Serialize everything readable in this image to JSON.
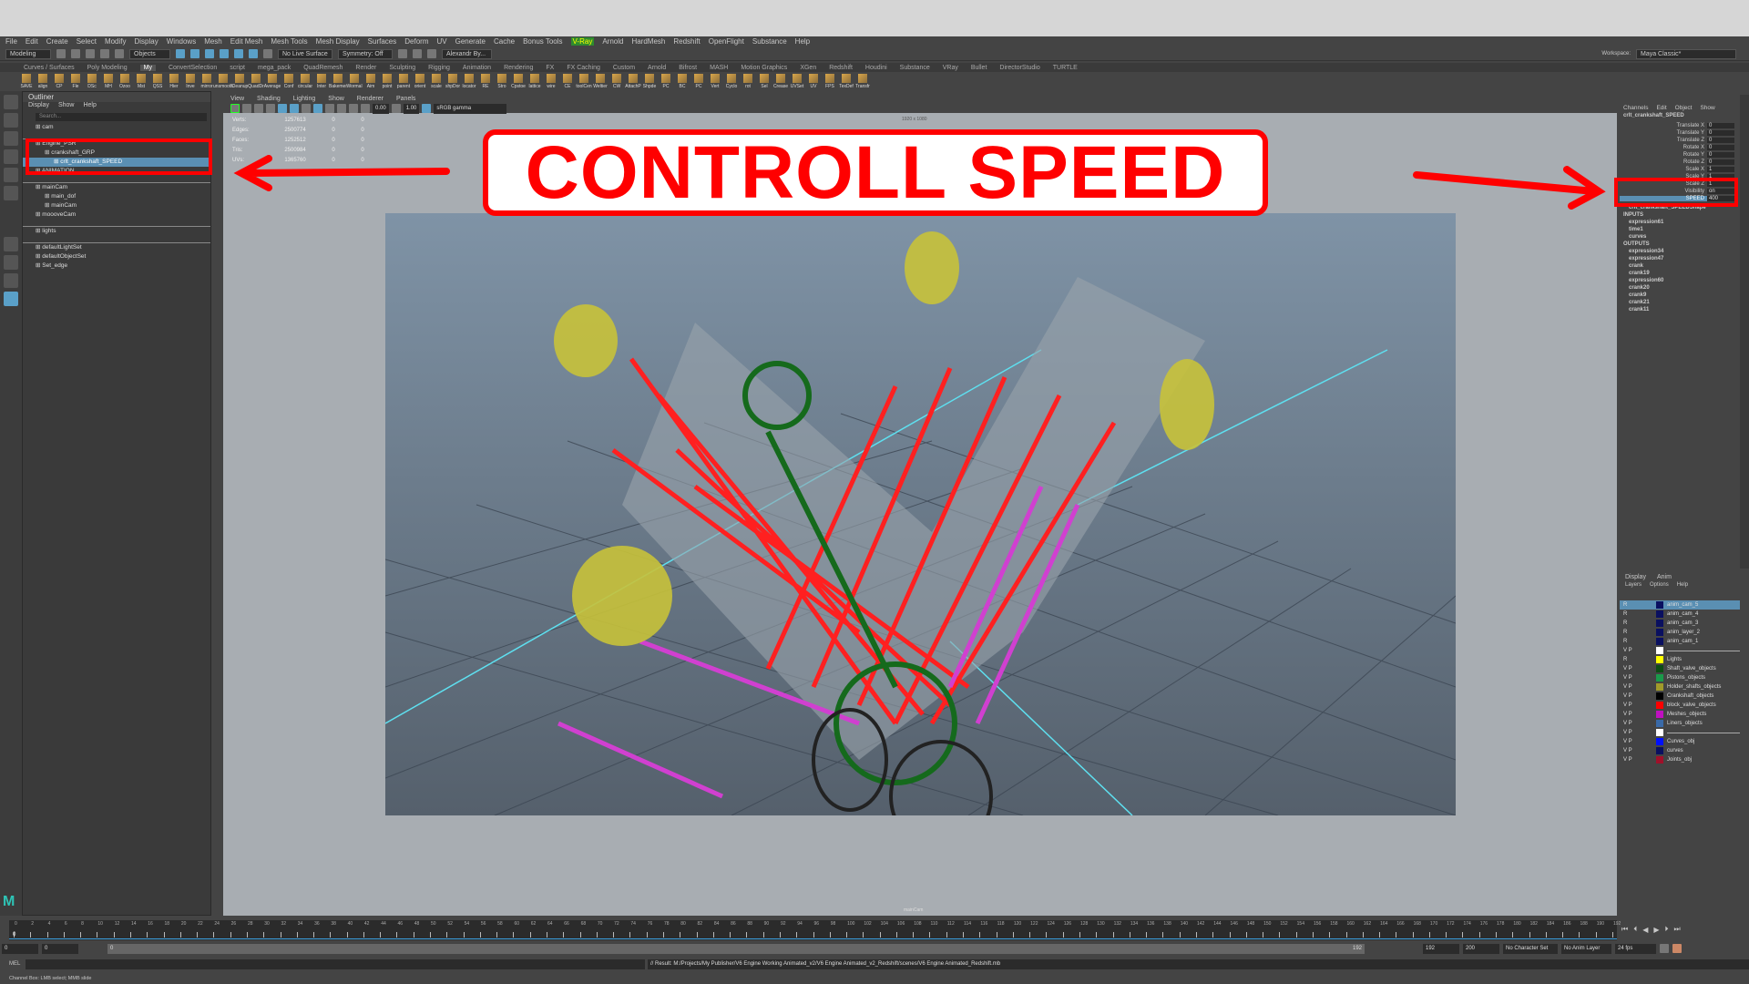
{
  "menubar": [
    "File",
    "Edit",
    "Create",
    "Select",
    "Modify",
    "Display",
    "Windows",
    "Mesh",
    "Edit Mesh",
    "Mesh Tools",
    "Mesh Display",
    "Surfaces",
    "Deform",
    "UV",
    "Generate",
    "Cache",
    "Bonus Tools",
    "V-Ray",
    "Arnold",
    "HardMesh",
    "Redshift",
    "OpenFlight",
    "Substance",
    "Help"
  ],
  "statusline": {
    "mode": "Modeling",
    "select_mode": "Objects",
    "live_surface": "No Live Surface",
    "symmetry": "Symmetry: Off",
    "user": "Alexandr By...",
    "workspace_label": "Workspace:",
    "workspace": "Maya Classic*"
  },
  "shelf_tabs": [
    "Curves / Surfaces",
    "Poly Modeling",
    "My",
    "ConvertSelection",
    "script",
    "mega_pack",
    "QuadRemesh",
    "Render",
    "Sculpting",
    "Rigging",
    "Animation",
    "Rendering",
    "FX",
    "FX Caching",
    "Custom",
    "Arnold",
    "Bifrost",
    "MASH",
    "Motion Graphics",
    "XGen",
    "Redshift",
    "Houdini",
    "Substance",
    "VRay",
    "Bullet",
    "DirectorStudio",
    "TURTLE"
  ],
  "shelf_active": "My",
  "shelf_buttons": [
    "SAVE",
    "align",
    "CP",
    "Fle",
    "DSc",
    "MH",
    "Ozoo",
    "Mst",
    "QSS",
    "Hier",
    "Inve",
    "mirror",
    "unsmooth",
    "Cleanup",
    "QuadDr",
    "Average",
    "Conf",
    "circular",
    "Inter",
    "Bakemer",
    "Wormal",
    "Aim",
    "point",
    "parent",
    "orient",
    "scale",
    "shpDor",
    "locator",
    "RE",
    "Stro",
    "Cpstoe",
    "lattice",
    "wire",
    "CE",
    "toolCen",
    "Weltier",
    "CW",
    "AttachP",
    "Shpde",
    "PC",
    "BC",
    "PC",
    "Vert",
    "Cyclo",
    "rot",
    "Sel",
    "Crease",
    "UVSet",
    "UV",
    "FPS",
    "TexDef",
    "Transfr"
  ],
  "outliner": {
    "title": "Outliner",
    "menus": [
      "Display",
      "Show",
      "Help"
    ],
    "search_placeholder": "Search...",
    "items": [
      {
        "label": "cam",
        "indent": 0,
        "sel": false
      },
      {
        "label": "",
        "indent": 0,
        "sep": true
      },
      {
        "label": "Engine_PSR",
        "indent": 0
      },
      {
        "label": "crankshaft_GRP",
        "indent": 1
      },
      {
        "label": "crlt_crankshaft_SPEED",
        "indent": 2,
        "sel": true
      },
      {
        "label": "ANIMATION",
        "indent": 0
      },
      {
        "label": "",
        "indent": 0,
        "sep": true
      },
      {
        "label": "mainCam",
        "indent": 0
      },
      {
        "label": "main_dof",
        "indent": 1
      },
      {
        "label": "mainCam",
        "indent": 1
      },
      {
        "label": "moooveCam",
        "indent": 0
      },
      {
        "label": "",
        "indent": 0,
        "sep": true
      },
      {
        "label": "lights",
        "indent": 0
      },
      {
        "label": "",
        "indent": 0,
        "sep": true
      },
      {
        "label": "defaultLightSet",
        "indent": 0
      },
      {
        "label": "defaultObjectSet",
        "indent": 0
      },
      {
        "label": "Set_edge",
        "indent": 0
      }
    ]
  },
  "viewport": {
    "menus": [
      "View",
      "Shading",
      "Lighting",
      "Show",
      "Renderer",
      "Panels"
    ],
    "exposure": "0.00",
    "gamma": "1.00",
    "color_space": "sRGB gamma",
    "resolution": "1920 x 1080",
    "camera": "mainCam",
    "hud": [
      [
        "Verts:",
        "1257613",
        "0",
        "0"
      ],
      [
        "Edges:",
        "2500774",
        "0",
        "0"
      ],
      [
        "Faces:",
        "1252512",
        "0",
        "0"
      ],
      [
        "Tris:",
        "2500984",
        "0",
        "0"
      ],
      [
        "UVs:",
        "1365760",
        "0",
        "0"
      ]
    ],
    "banner": "CONTROLL SPEED"
  },
  "channel_box": {
    "menus": [
      "Channels",
      "Edit",
      "Object",
      "Show"
    ],
    "node": "crlt_crankshaft_SPEED",
    "attrs": [
      [
        "Translate X",
        "0"
      ],
      [
        "Translate Y",
        "0"
      ],
      [
        "Translate Z",
        "0"
      ],
      [
        "Rotate X",
        "0"
      ],
      [
        "Rotate Y",
        "0"
      ],
      [
        "Rotate Z",
        "0"
      ],
      [
        "Scale X",
        "1"
      ],
      [
        "Scale Y",
        "1"
      ],
      [
        "Scale Z",
        "1"
      ],
      [
        "Visibility",
        "on"
      ],
      [
        "SPEED",
        "400"
      ]
    ],
    "shape": "crlt_crankshaft_SPEEDShape",
    "inputs_label": "INPUTS",
    "inputs": [
      "expression61",
      "time1",
      "curves"
    ],
    "outputs_label": "OUTPUTS",
    "outputs": [
      "expression34",
      "expression47",
      "crank",
      "crank19",
      "expression60",
      "crank20",
      "crank9",
      "crank21",
      "crank11"
    ]
  },
  "layers": {
    "tabs": [
      "Display",
      "Anim"
    ],
    "menus": [
      "Layers",
      "Options",
      "Help"
    ],
    "rows": [
      {
        "vp": "R",
        "name": "anim_cam_5",
        "color": "#0a1060",
        "sel": true
      },
      {
        "vp": "R",
        "name": "anim_cam_4",
        "color": "#0a1060"
      },
      {
        "vp": "R",
        "name": "anim_cam_3",
        "color": "#0a1060"
      },
      {
        "vp": "R",
        "name": "anim_layer_2",
        "color": "#0a1060"
      },
      {
        "vp": "R",
        "name": "anim_cam_1",
        "color": "#0a1060"
      },
      {
        "vp": "V P",
        "name": "",
        "color": "#ffffff",
        "sep": true
      },
      {
        "vp": "R",
        "name": "Lights",
        "color": "#ffff00"
      },
      {
        "vp": "V P",
        "name": "Shaft_valve_objects",
        "color": "#0d4d14"
      },
      {
        "vp": "V P",
        "name": "Pistons_objects",
        "color": "#1a9a4a"
      },
      {
        "vp": "V P",
        "name": "Holder_shafts_objects",
        "color": "#a09a2a"
      },
      {
        "vp": "V P",
        "name": "Crankshaft_objects",
        "color": "#000000"
      },
      {
        "vp": "V P",
        "name": "block_valve_objects",
        "color": "#ff0000"
      },
      {
        "vp": "V P",
        "name": "Meshes_objects",
        "color": "#c010c0"
      },
      {
        "vp": "V P",
        "name": "Liners_objects",
        "color": "#3a6aa8"
      },
      {
        "vp": "V P",
        "name": "",
        "color": "#ffffff",
        "sep": true
      },
      {
        "vp": "V P",
        "name": "Curves_obj",
        "color": "#0010ff"
      },
      {
        "vp": "V P",
        "name": "curves",
        "color": "#0a1060"
      },
      {
        "vp": "V P",
        "name": "Joints_obj",
        "color": "#a0102a"
      }
    ]
  },
  "timeline": {
    "start": 0,
    "end": 192,
    "step": 2,
    "current": "0"
  },
  "range": {
    "start": "0",
    "anim_start": "0",
    "slider_start": "0",
    "slider_end": "192",
    "end": "192",
    "anim_end": "200",
    "character_set": "No Character Set",
    "anim_layer": "No Anim Layer",
    "fps": "24 fps"
  },
  "command": {
    "lang": "MEL",
    "result": "// Result: M:/Projects/My Publisher/V6 Engine Working Animated_v2/V6 Engine Animated_v2_Redshift/scenes/V6 Engine Animated_Redshift.mb"
  },
  "help_line": "Channel Box: LMB select; MMB slide",
  "colors": {
    "highlight": "#5a8fb3",
    "annotation_red": "#ff0000",
    "timeline_blue": "#3aa0e0"
  }
}
